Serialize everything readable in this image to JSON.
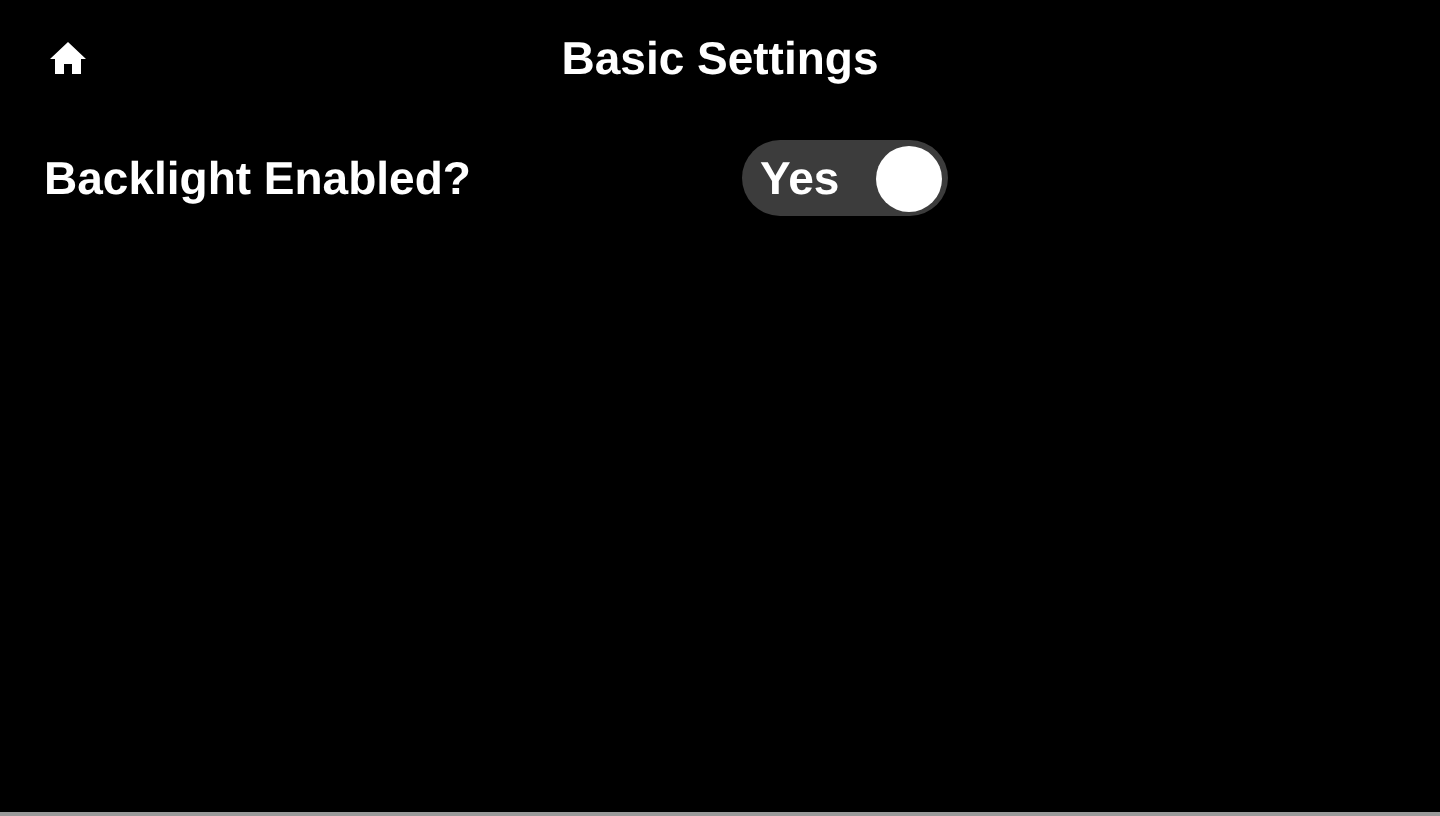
{
  "header": {
    "title": "Basic Settings"
  },
  "settings": [
    {
      "kind": "toggle",
      "label": "Backlight Enabled?",
      "on": true,
      "state_text": "Yes"
    }
  ]
}
